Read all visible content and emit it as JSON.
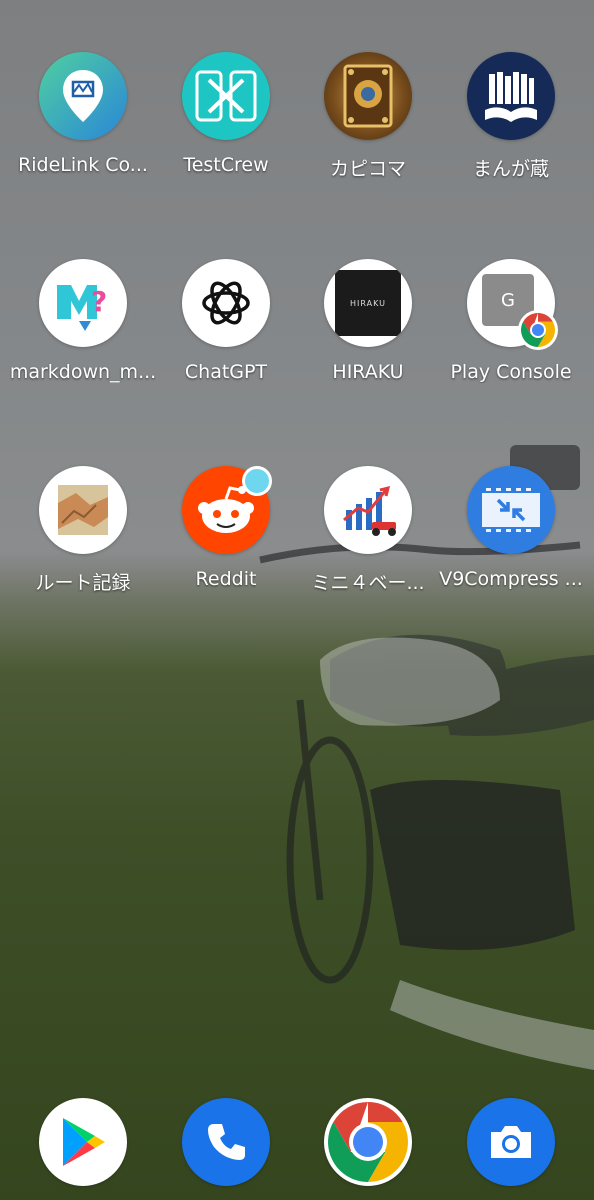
{
  "home_screen": {
    "apps": [
      {
        "label": "RideLink Co...",
        "icon": "ridelink-map-icon"
      },
      {
        "label": "TestCrew",
        "icon": "testcrew-phones-icon"
      },
      {
        "label": "カピコマ",
        "icon": "kapikoma-book-icon"
      },
      {
        "label": "まんが蔵",
        "icon": "mangagura-library-icon"
      },
      {
        "label": "markdown_m...",
        "icon": "markdown-m-icon"
      },
      {
        "label": "ChatGPT",
        "icon": "chatgpt-logo-icon"
      },
      {
        "label": "HIRAKU",
        "icon": "hiraku-icon"
      },
      {
        "label": "Play Console",
        "icon": "play-console-icon"
      },
      {
        "label": "ルート記録",
        "icon": "route-record-map-icon"
      },
      {
        "label": "Reddit",
        "icon": "reddit-icon"
      },
      {
        "label": "ミニ４ベー...",
        "icon": "mini4wd-chart-icon"
      },
      {
        "label": "V9Compress ...",
        "icon": "v9compress-icon"
      }
    ],
    "hiraku_logo_text": "HIRAKU",
    "play_console_badge_text": "G"
  },
  "dock": [
    {
      "name": "play-store",
      "icon": "play-store-icon"
    },
    {
      "name": "phone",
      "icon": "phone-icon"
    },
    {
      "name": "chrome",
      "icon": "chrome-icon"
    },
    {
      "name": "camera",
      "icon": "camera-icon"
    }
  ],
  "colors": {
    "testcrew": "#1ec6c3",
    "reddit": "#ff4500",
    "blue_app": "#2f7de1",
    "mangagura_bg": "#152a57"
  }
}
